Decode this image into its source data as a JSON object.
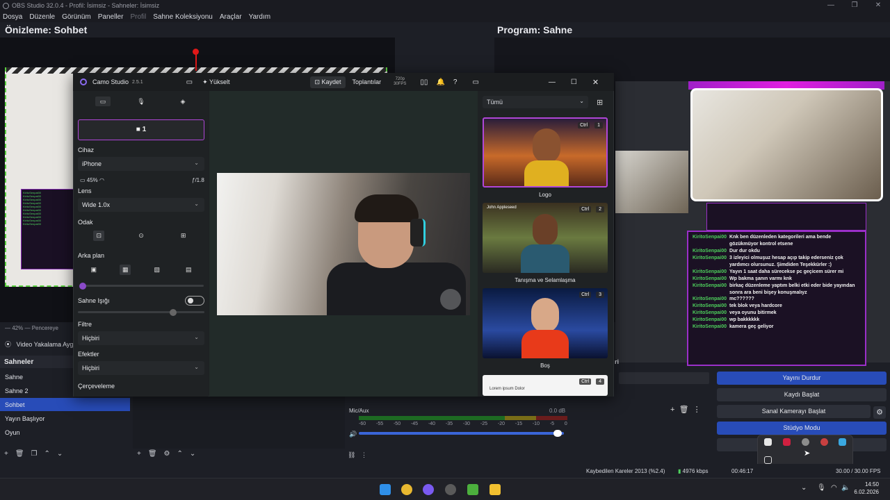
{
  "obs": {
    "window_title": "OBS Studio 32.0.4 - Profil: İsimsiz - Sahneler: İsimsiz",
    "window_controls": [
      "—",
      "❐",
      "✕"
    ],
    "menu": [
      "Dosya",
      "Düzenle",
      "Görünüm",
      "Paneller",
      "Profil",
      "Sahne Koleksiyonu",
      "Araçlar",
      "Yardım"
    ],
    "preview_title": "Önizleme: Sohbet",
    "program_title": "Program: Sahne",
    "zoom_text": "42%",
    "window_label": "Pencereye",
    "source_label": "Video Yakalama Ayg",
    "scenes_title": "Sahneler",
    "scenes": [
      "Sahne",
      "Sahne 2",
      "Sohbet",
      "Yayın Başlıyor",
      "Oyun"
    ],
    "selected_scene": "Sohbet",
    "transitions_label": "ri",
    "controls": {
      "stop_stream": "Yayını Durdur",
      "start_record": "Kaydı Başlat",
      "virtual_cam": "Sanal Kamerayı Başlat",
      "studio_mode": "Stüdyo Modu"
    },
    "mixer": {
      "channel": "Mic/Aux",
      "db": "0.0 dB",
      "ticks": [
        "-60",
        "-55",
        "-50",
        "-45",
        "-40",
        "-35",
        "-30",
        "-25",
        "-20",
        "-15",
        "-10",
        "-5",
        "0"
      ],
      "volume_fraction": 0.97
    },
    "status": {
      "dropped": "Kaybedilen Kareler 2013 (%2.4)",
      "bitrate": "4976 kbps",
      "stream_time": "00:46:17",
      "fps": "30.00 / 30.00 FPS"
    }
  },
  "chat": {
    "messages": [
      {
        "user": "KiritoSenpai00",
        "text": "Knk ben düzenleden kategorileri ama bende gözükmüyor kontrol etsene"
      },
      {
        "user": "KiritoSenpai00",
        "text": "Dur dur okdu"
      },
      {
        "user": "KiritoSenpai00",
        "text": "3 izleyici olmuşuz hesap açıp takip ederseniz çok yardımcı olursunuz. Şimdiden Teşekkürler :)"
      },
      {
        "user": "KiritoSenpai00",
        "text": "Yayın 1 saat daha sürecekse pc geçicem sürer mi"
      },
      {
        "user": "KiritoSenpai00",
        "text": "Wp bakma şanın varmı knk"
      },
      {
        "user": "KiritoSenpai00",
        "text": "birkaç düzenleme yaptım belki etki eder bide yayından sonra ara beni bişey konuşmalıyz"
      },
      {
        "user": "KiritoSenpai00",
        "text": "mc??????"
      },
      {
        "user": "KiritoSenpai00",
        "text": "tek blok veya hardcore"
      },
      {
        "user": "KiritoSenpai00",
        "text": "veya oyunu bitirmek"
      },
      {
        "user": "KiritoSenpai00",
        "text": "wp bakkkkkk"
      },
      {
        "user": "KiritoSenpai00",
        "text": "kamera geç geliyor"
      }
    ]
  },
  "camo": {
    "app_name": "Camo Studio",
    "version": "2.5.1",
    "upgrade": "Yükselt",
    "record": "Kaydet",
    "meetings": "Toplantılar",
    "resolution": "720p",
    "fps": "30FPS",
    "camera_slot": "1",
    "device_label": "Cihaz",
    "device_value": "iPhone",
    "battery": "45%",
    "aperture": "ƒ/1.8",
    "lens_label": "Lens",
    "lens_value": "Wide 1.0x",
    "focus_label": "Odak",
    "background_label": "Arka plan",
    "stage_light_label": "Sahne Işığı",
    "filter_label": "Filtre",
    "filter_value": "Hiçbiri",
    "effects_label": "Efektler",
    "effects_value": "Hiçbiri",
    "framing_label": "Çerçeveleme",
    "bg_filter": "Tümü",
    "backgrounds": [
      {
        "label": "Logo",
        "ctrl": "Ctrl",
        "num": "1"
      },
      {
        "label": "Tanışma ve Selamlaşma",
        "ctrl": "Ctrl",
        "num": "2",
        "overlay": "John Appleseed"
      },
      {
        "label": "Boş",
        "ctrl": "Ctrl",
        "num": "3"
      },
      {
        "label": "",
        "ctrl": "Ctrl",
        "num": "4",
        "overlay": "Lorem ipsum Dolor"
      }
    ]
  },
  "taskbar": {
    "time": "14:50",
    "date": "6.02.2026"
  }
}
